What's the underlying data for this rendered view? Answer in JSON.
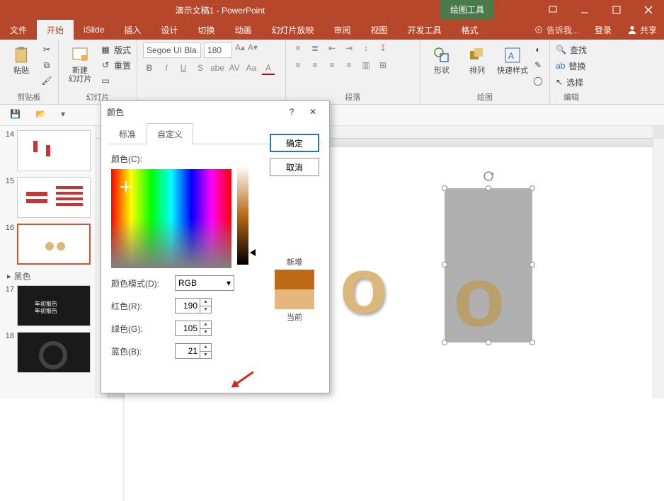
{
  "titlebar": {
    "title": "演示文稿1 - PowerPoint",
    "tools_tab": "绘图工具"
  },
  "tabs": {
    "file": "文件",
    "home": "开始",
    "islide": "iSlide",
    "insert": "插入",
    "design": "设计",
    "transitions": "切换",
    "animations": "动画",
    "slideshow": "幻灯片放映",
    "review": "审阅",
    "view": "视图",
    "developer": "开发工具",
    "format": "格式",
    "tell_me": "告诉我...",
    "login": "登录",
    "share": "共享"
  },
  "ribbon": {
    "clipboard": {
      "paste": "粘贴",
      "label": "剪贴板"
    },
    "slides": {
      "new_slide": "新建\n幻灯片",
      "layout": "版式",
      "reset": "重置",
      "label": "幻灯片"
    },
    "font": {
      "name": "Segoe UI Bla",
      "size": "180"
    },
    "paragraph": {
      "label": "段落"
    },
    "drawing": {
      "shapes": "形状",
      "arrange": "排列",
      "quick_styles": "快速样式",
      "label": "绘图"
    },
    "editing": {
      "find": "查找",
      "replace": "替换",
      "select": "选择",
      "label": "编辑"
    }
  },
  "thumbs": {
    "s14": "14",
    "s15": "15",
    "s16": "16",
    "s17": "17",
    "s18": "18",
    "section_black": "黑色"
  },
  "dialog": {
    "title": "颜色",
    "tab_standard": "标准",
    "tab_custom": "自定义",
    "ok": "确定",
    "cancel": "取消",
    "colors_label": "颜色(C):",
    "mode_label": "颜色模式(D):",
    "mode_value": "RGB",
    "red_label": "红色(R):",
    "green_label": "绿色(G):",
    "blue_label": "蓝色(B):",
    "red_value": "190",
    "green_value": "105",
    "blue_value": "21",
    "new_label": "新增",
    "current_label": "当前"
  },
  "colors": {
    "accent": "#b7472a",
    "new_color": "#be6915",
    "current_color": "#e5b77e"
  }
}
